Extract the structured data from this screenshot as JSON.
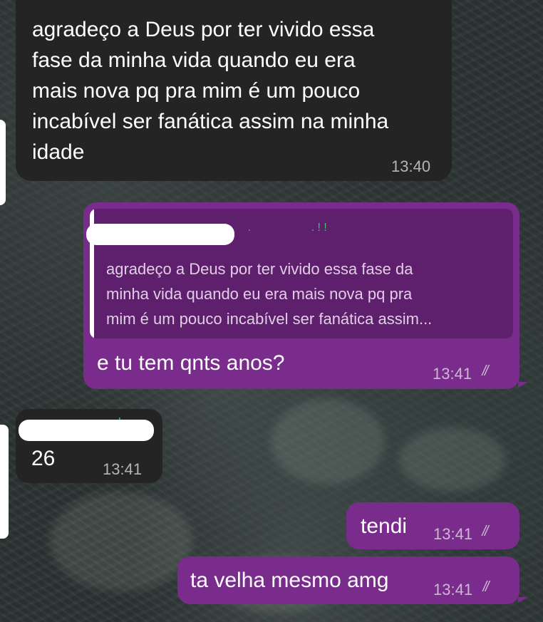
{
  "chat": {
    "messages": [
      {
        "direction": "incoming",
        "text": "agradeço a Deus por ter vivido essa\nfase da minha vida quando eu era\nmais nova pq pra mim é um pouco\nincabível ser fanática assim na minha\nidade",
        "time": "13:40"
      },
      {
        "direction": "outgoing",
        "quoted_text": "agradeço a Deus por ter vivido essa fase da\nminha vida quando eu era mais nova pq pra\nmim é um pouco incabível ser fanática assim...",
        "text": "e tu tem qnts anos?",
        "time": "13:41",
        "status_icon": "double-check-icon"
      },
      {
        "direction": "incoming",
        "text": "26",
        "time": "13:41"
      },
      {
        "direction": "outgoing",
        "text": "tendi",
        "time": "13:41",
        "status_icon": "double-check-icon"
      },
      {
        "direction": "outgoing",
        "text": "ta velha mesmo amg",
        "time": "13:41",
        "status_icon": "double-check-icon"
      }
    ]
  },
  "colors": {
    "incoming_bubble": "#242424",
    "outgoing_bubble": "#7a2c8c",
    "quote_background": "#5e1f6c",
    "wallpaper": "#2b3433"
  }
}
